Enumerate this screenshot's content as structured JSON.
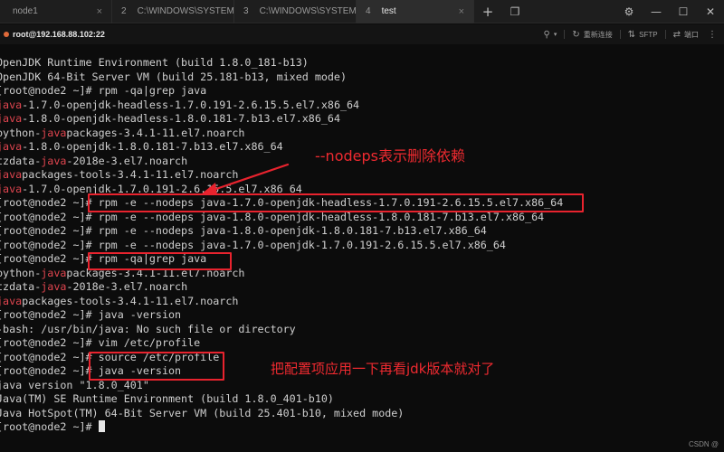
{
  "tabs": [
    {
      "num": "",
      "title": "node1",
      "active": false
    },
    {
      "num": "2",
      "title": "C:\\WINDOWS\\SYSTEM...",
      "active": false
    },
    {
      "num": "3",
      "title": "C:\\WINDOWS\\SYSTEM...",
      "active": false
    },
    {
      "num": "4",
      "title": "test",
      "active": true
    }
  ],
  "tab_close_glyph": "×",
  "session": {
    "host": "root@192.168.88.102:22",
    "tools": [
      "重新连接",
      "SFTP",
      "端口"
    ]
  },
  "terminal": {
    "lines": [
      [
        {
          "t": "OpenJDK Runtime Environment (build 1.8.0_181-b13)"
        }
      ],
      [
        {
          "t": "OpenJDK 64-Bit Server VM (build 25.181-b13, mixed mode)"
        }
      ],
      [
        {
          "t": "[root@node2 ~]# rpm -qa|grep java"
        }
      ],
      [
        {
          "t": "java",
          "c": "red"
        },
        {
          "t": "-1.7.0-openjdk-headless-1.7.0.191-2.6.15.5.el7.x86_64"
        }
      ],
      [
        {
          "t": "java",
          "c": "red"
        },
        {
          "t": "-1.8.0-openjdk-headless-1.8.0.181-7.b13.el7.x86_64"
        }
      ],
      [
        {
          "t": "python-"
        },
        {
          "t": "java",
          "c": "red"
        },
        {
          "t": "packages-3.4.1-11.el7.noarch"
        }
      ],
      [
        {
          "t": "java",
          "c": "red"
        },
        {
          "t": "-1.8.0-openjdk-1.8.0.181-7.b13.el7.x86_64"
        }
      ],
      [
        {
          "t": "tzdata-"
        },
        {
          "t": "java",
          "c": "red"
        },
        {
          "t": "-2018e-3.el7.noarch"
        }
      ],
      [
        {
          "t": "java",
          "c": "red"
        },
        {
          "t": "packages-tools-3.4.1-11.el7.noarch"
        }
      ],
      [
        {
          "t": "java",
          "c": "red"
        },
        {
          "t": "-1.7.0-openjdk-1.7.0.191-2.6.15.5.el7.x86_64"
        }
      ],
      [
        {
          "t": "[root@node2 ~]# rpm -e --nodeps java-1.7.0-openjdk-headless-1.7.0.191-2.6.15.5.el7.x86_64"
        }
      ],
      [
        {
          "t": "[root@node2 ~]# rpm -e --nodeps java-1.8.0-openjdk-headless-1.8.0.181-7.b13.el7.x86_64"
        }
      ],
      [
        {
          "t": "[root@node2 ~]# rpm -e --nodeps java-1.8.0-openjdk-1.8.0.181-7.b13.el7.x86_64"
        }
      ],
      [
        {
          "t": "[root@node2 ~]# rpm -e --nodeps java-1.7.0-openjdk-1.7.0.191-2.6.15.5.el7.x86_64"
        }
      ],
      [
        {
          "t": "[root@node2 ~]# rpm -qa|grep java"
        }
      ],
      [
        {
          "t": "python-"
        },
        {
          "t": "java",
          "c": "red"
        },
        {
          "t": "packages-3.4.1-11.el7.noarch"
        }
      ],
      [
        {
          "t": "tzdata-"
        },
        {
          "t": "java",
          "c": "red"
        },
        {
          "t": "-2018e-3.el7.noarch"
        }
      ],
      [
        {
          "t": "java",
          "c": "red"
        },
        {
          "t": "packages-tools-3.4.1-11.el7.noarch"
        }
      ],
      [
        {
          "t": "[root@node2 ~]# java -version"
        }
      ],
      [
        {
          "t": "-bash: /usr/bin/java: No such file or directory"
        }
      ],
      [
        {
          "t": "[root@node2 ~]# vim /etc/profile"
        }
      ],
      [
        {
          "t": "[root@node2 ~]# source /etc/profile"
        }
      ],
      [
        {
          "t": "[root@node2 ~]# java -version"
        }
      ],
      [
        {
          "t": "java version \"1.8.0_401\""
        }
      ],
      [
        {
          "t": "Java(TM) SE Runtime Environment (build 1.8.0_401-b10)"
        }
      ],
      [
        {
          "t": "Java HotSpot(TM) 64-Bit Server VM (build 25.401-b10, mixed mode)"
        }
      ],
      [
        {
          "t": "[root@node2 ~]# "
        }
      ]
    ]
  },
  "annotations": {
    "nodeps_note": "--nodeps表示删除依赖",
    "profile_note": "把配置项应用一下再看jdk版本就对了"
  },
  "watermark": "CSDN @"
}
